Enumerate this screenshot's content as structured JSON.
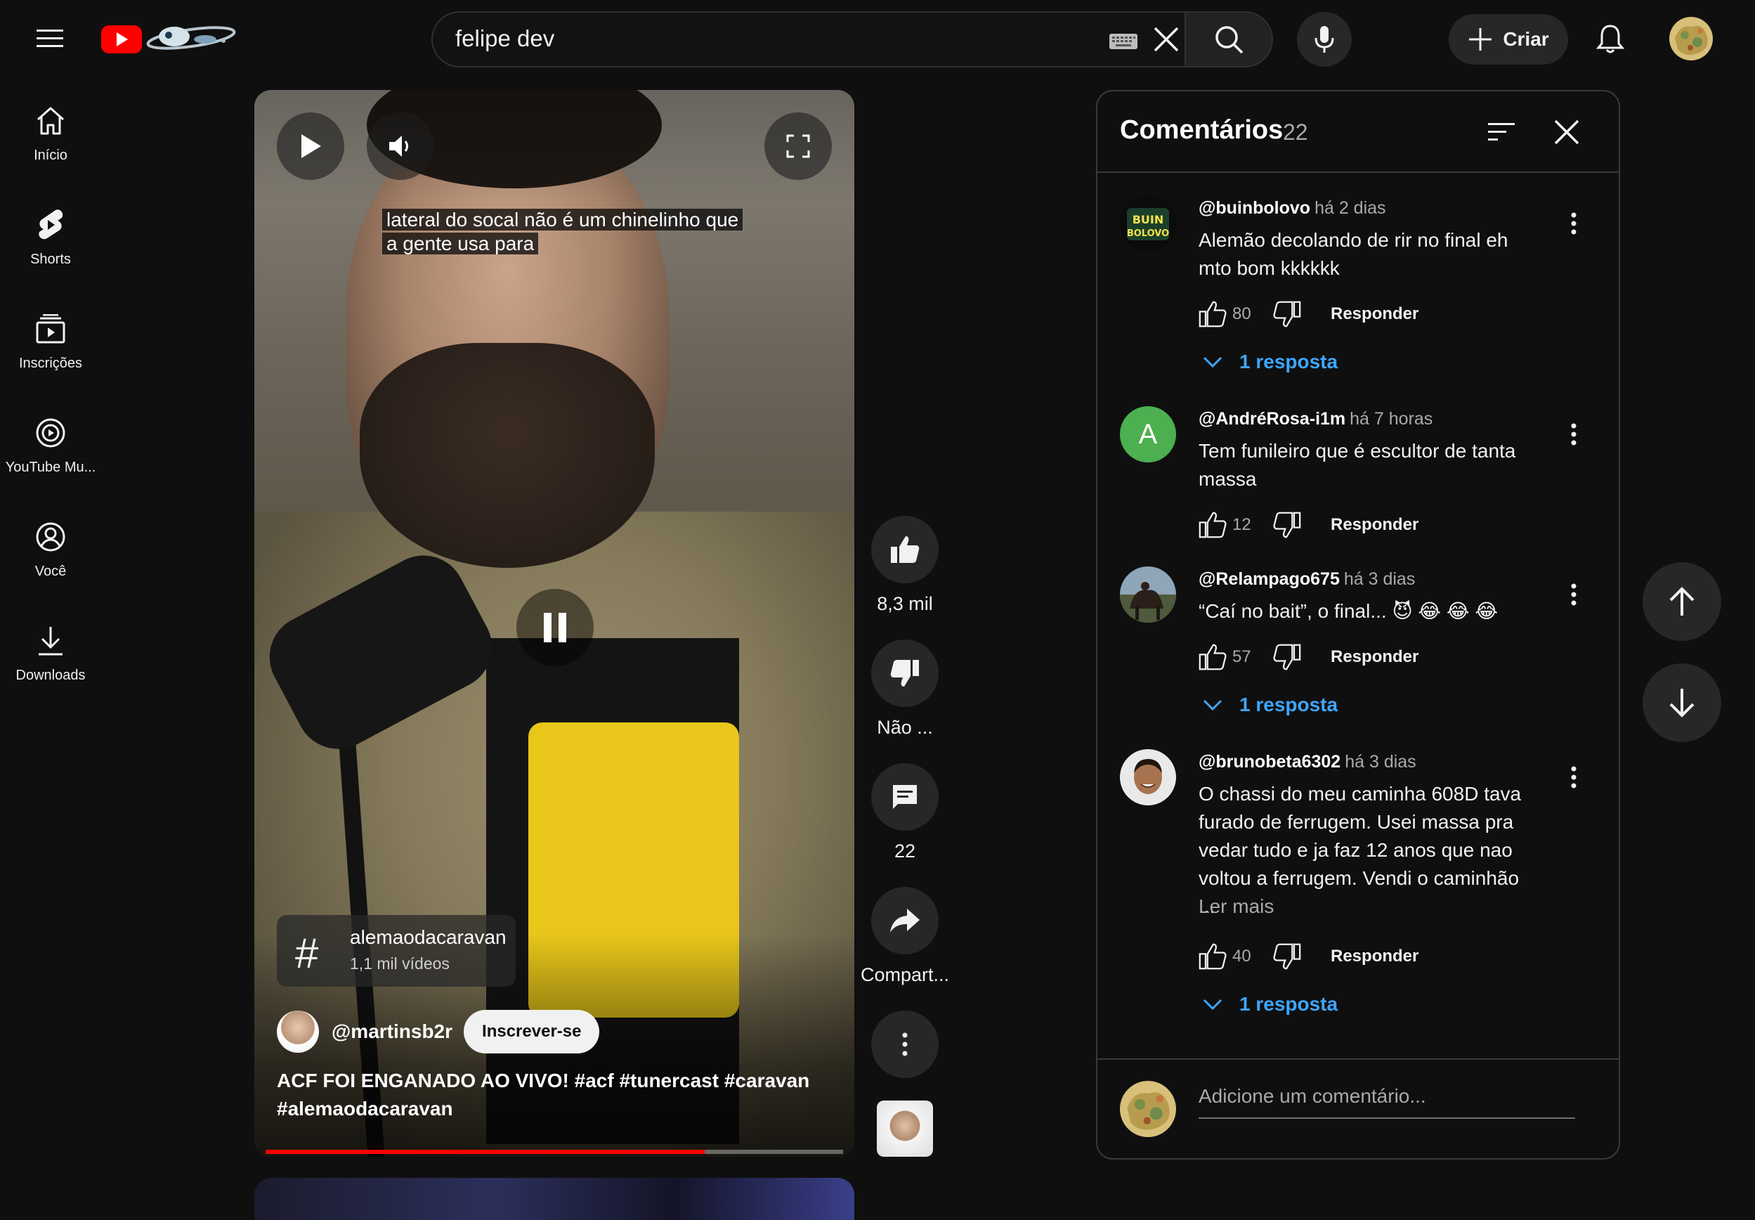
{
  "header": {
    "search_value": "felipe dev",
    "create_label": "Criar",
    "icons": {
      "menu": "hamburger-icon",
      "logo": "youtube-logo",
      "keyboard": "keyboard-icon",
      "clear": "close-icon",
      "search": "search-icon",
      "mic": "microphone-icon",
      "create": "plus-icon",
      "notifications": "bell-icon"
    }
  },
  "sidebar": {
    "items": [
      {
        "label": "Início",
        "icon": "home-icon"
      },
      {
        "label": "Shorts",
        "icon": "shorts-icon"
      },
      {
        "label": "Inscrições",
        "icon": "subscriptions-icon"
      },
      {
        "label": "YouTube Mu...",
        "icon": "youtube-music-icon"
      },
      {
        "label": "Você",
        "icon": "user-icon"
      },
      {
        "label": "Downloads",
        "icon": "download-icon"
      }
    ]
  },
  "video": {
    "caption": "lateral do socal não é um chinelinho que a gente usa para",
    "caption_line1": "lateral do socal não é um chinelinho que",
    "caption_line2": "a gente usa para",
    "hashtag": {
      "title": "alemaodacaravan",
      "subtitle": "1,1 mil vídeos"
    },
    "channel": "@martinsb2r",
    "subscribe_label": "Inscrever-se",
    "title": "ACF FOI ENGANADO AO VIVO! #acf #tunercast #caravan #alemaodacaravan",
    "progress_fraction": 0.76,
    "state": "paused"
  },
  "actions": {
    "like_label": "8,3 mil",
    "dislike_label": "Não ...",
    "comments_label": "22",
    "share_label": "Compart..."
  },
  "comments": {
    "title": "Comentários",
    "count": "22",
    "reply_label": "Responder",
    "read_more": "Ler mais",
    "add_placeholder": "Adicione um comentário...",
    "items": [
      {
        "handle": "@buinbolovo",
        "time": "há 2 dias",
        "text": "Alemão decolando de rir no final eh mto bom kkkkkk",
        "likes": "80",
        "replies": "1 resposta"
      },
      {
        "handle": "@AndréRosa-i1m",
        "time": "há 7 horas",
        "text": "Tem funileiro que é escultor de tanta massa",
        "likes": "12",
        "avatar_letter": "A",
        "avatar_color": "#4caf50"
      },
      {
        "handle": "@Relampago675",
        "time": "há 3 dias",
        "text": "“Caí no bait”, o final... 😈 😂 😂 😂",
        "likes": "57",
        "replies": "1 resposta"
      },
      {
        "handle": "@brunobeta6302",
        "time": "há 3 dias",
        "text": "O chassi do meu caminha 608D tava furado de ferrugem. Usei massa pra vedar tudo e ja faz 12 anos que nao voltou a ferrugem. Vendi o caminhão ...",
        "likes": "40",
        "replies": "1 resposta"
      }
    ]
  },
  "colors": {
    "background": "#0f0f0f",
    "accent_red": "#ff0000",
    "link_blue": "#3ea6ff",
    "surface": "#272727"
  }
}
